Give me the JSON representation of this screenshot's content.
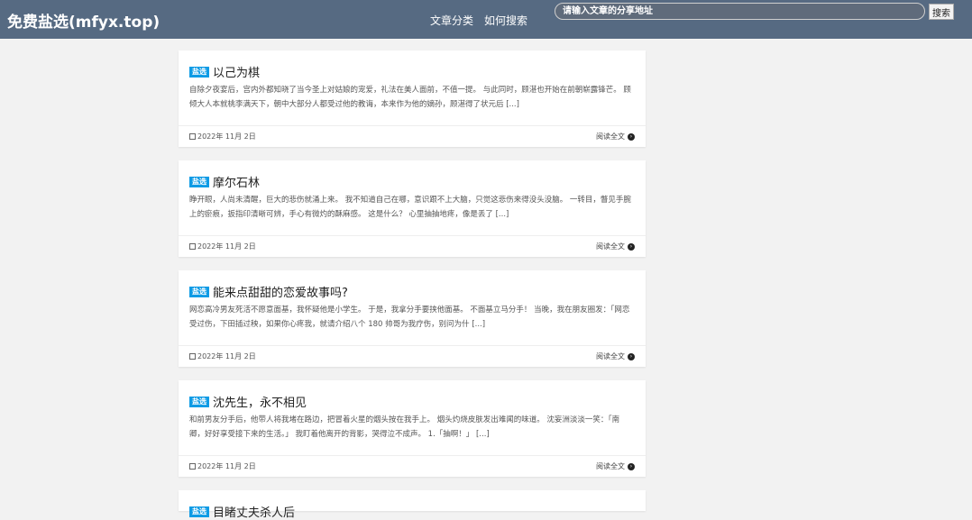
{
  "header": {
    "site_title": "免费盐选(mfyx.top)",
    "nav": [
      {
        "label": "文章分类"
      },
      {
        "label": "如何搜索"
      }
    ],
    "search": {
      "placeholder": "请输入文章的分享地址",
      "button_label": "搜索"
    }
  },
  "posts": [
    {
      "badge": "盐选",
      "title": "以己为棋",
      "excerpt": "自除夕夜宴后，宫内外都知晓了当今圣上对姑娘的宠爱，礼法在美人面前，不值一提。 与此同时，顾湛也开始在前朝崭露锋芒。 顾倾大人本就桃李满天下，朝中大部分人都受过他的教诲，本来作为他的嫡孙，顾湛得了状元后 [...]",
      "date": "2022年 11月 2日",
      "read_more": "阅读全文"
    },
    {
      "badge": "盐选",
      "title": "摩尔石林",
      "excerpt": "睁开眼，人尚未清醒，巨大的悲伤就涌上来。 我不知道自己在哪，意识跟不上大脑，只觉这悲伤来得没头没脑。 一转目，瞥见手腕上的瘀痕，扳指印清晰可辨，手心有微灼的酥麻感。 这是什么？ 心里抽抽地疼，像是丢了 [...]",
      "date": "2022年 11月 2日",
      "read_more": "阅读全文"
    },
    {
      "badge": "盐选",
      "title": "能来点甜甜的恋爱故事吗?",
      "excerpt": "网恋高冷男友死活不愿意面基，我怀疑他是小学生。 于是，我拿分手要挟他面基。 不面基立马分手！ 当晚，我在朋友圈发：「网恋受过伤，下田插过秧，如果你心疼我，就请介绍八个 180 帅哥为我疗伤，别问为什 [...]",
      "date": "2022年 11月 2日",
      "read_more": "阅读全文"
    },
    {
      "badge": "盐选",
      "title": "沈先生，永不相见",
      "excerpt": "和前男友分手后，他带人将我堵在路边，把冒着火星的烟头按在我手上。 烟头灼烧皮肤发出难闻的味道。 沈妄洲淡淡一笑：「南卿，好好享受接下来的生活。」 我盯着他离开的背影，哭得泣不成声。 1.「抽啊！」 [...]",
      "date": "2022年 11月 2日",
      "read_more": "阅读全文"
    },
    {
      "badge": "盐选",
      "title": "目睹丈夫杀人后"
    }
  ]
}
